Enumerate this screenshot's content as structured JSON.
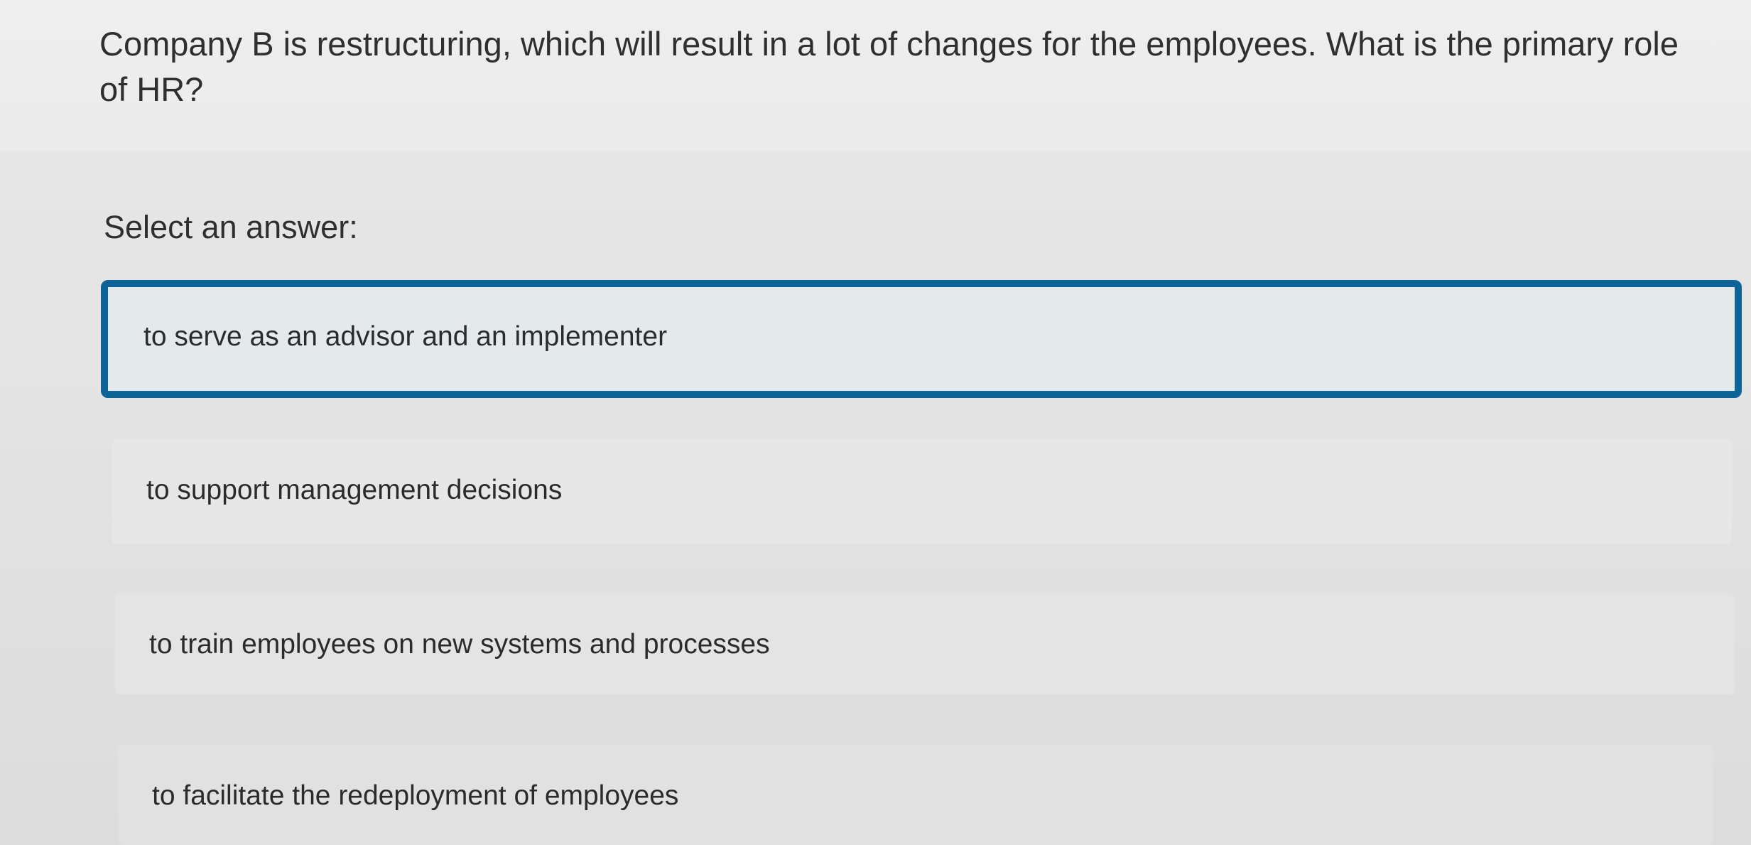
{
  "question": {
    "text": "Company B is restructuring, which will result in a lot of changes for the employees. What is the primary role of HR?"
  },
  "prompt": "Select an answer:",
  "options": [
    {
      "label": "to serve as an advisor and an implementer",
      "selected": true
    },
    {
      "label": "to support management decisions",
      "selected": false
    },
    {
      "label": "to train employees on new systems and processes",
      "selected": false
    },
    {
      "label": "to facilitate the redeployment of employees",
      "selected": false
    }
  ],
  "colors": {
    "selected_border": "#0e6496",
    "text": "#2b2b2b",
    "background": "#ececec"
  }
}
